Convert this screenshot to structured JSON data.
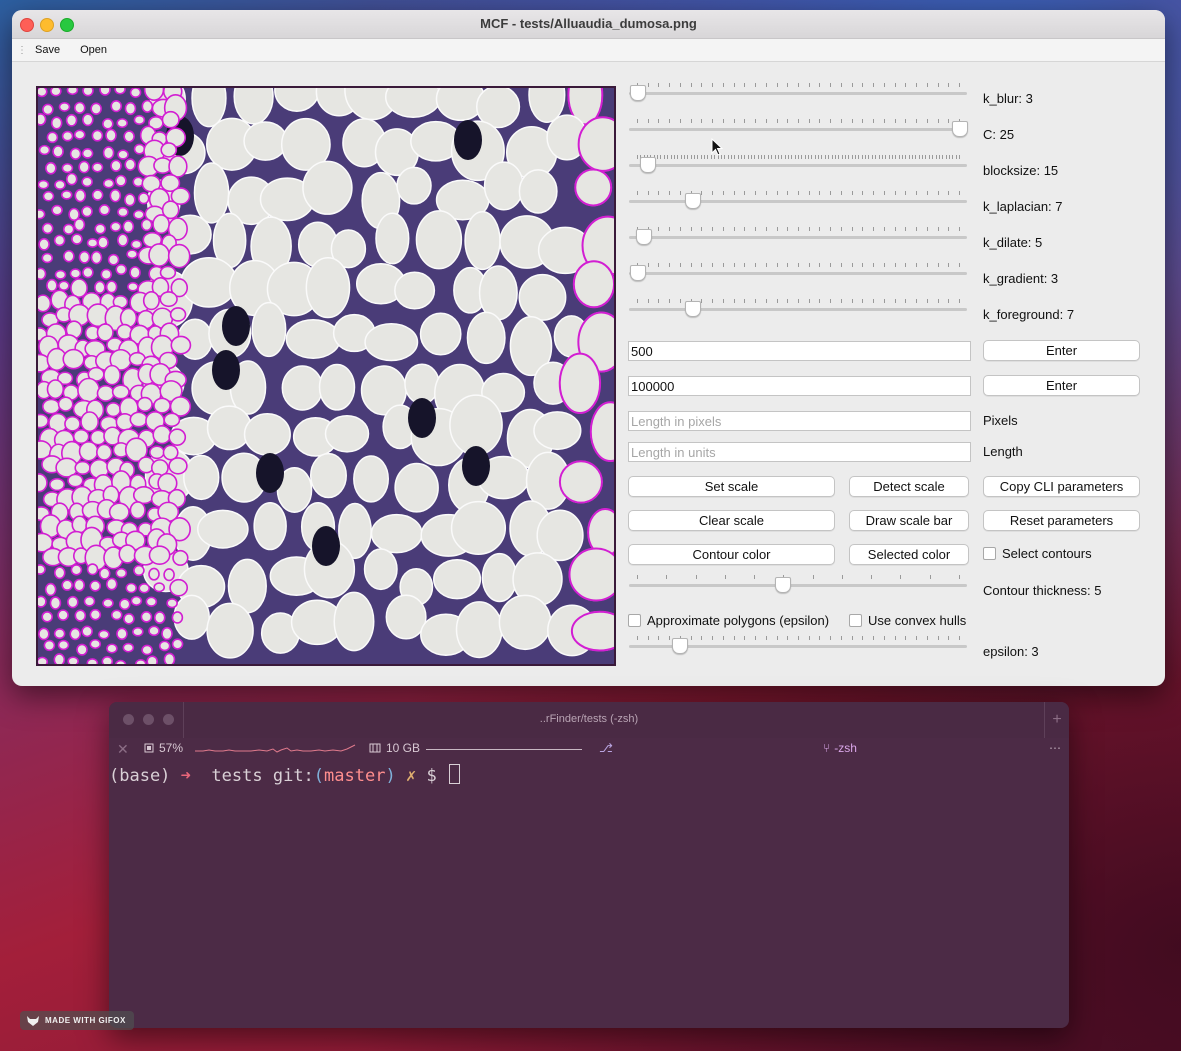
{
  "window": {
    "title": "MCF - tests/Alluaudia_dumosa.png",
    "menu": [
      "Save",
      "Open"
    ]
  },
  "sliders": [
    {
      "name": "k_blur",
      "label": "k_blur: 3",
      "fraction": 0.0
    },
    {
      "name": "C",
      "label": "C: 25",
      "fraction": 1.0
    },
    {
      "name": "blocksize",
      "label": "blocksize: 15",
      "fraction": 0.03
    },
    {
      "name": "k_laplacian",
      "label": "k_laplacian: 7",
      "fraction": 0.17
    },
    {
      "name": "k_dilate",
      "label": "k_dilate: 5",
      "fraction": 0.02
    },
    {
      "name": "k_gradient",
      "label": "k_gradient: 3",
      "fraction": 0.0
    },
    {
      "name": "k_foreground",
      "label": "k_foreground: 7",
      "fraction": 0.17
    }
  ],
  "inputs": {
    "min_area_value": "500",
    "max_area_value": "100000",
    "enter_label": "Enter",
    "pixels_placeholder": "Length in pixels",
    "pixels_label": "Pixels",
    "units_placeholder": "Length in units",
    "units_label": "Length"
  },
  "buttons": {
    "set_scale": "Set scale",
    "detect_scale": "Detect scale",
    "copy_cli": "Copy CLI parameters",
    "clear_scale": "Clear scale",
    "draw_scale_bar": "Draw scale bar",
    "reset_parameters": "Reset parameters",
    "contour_color": "Contour color",
    "selected_color": "Selected color"
  },
  "checkboxes": {
    "select_contours": "Select contours",
    "approx_polygons": "Approximate polygons (epsilon)",
    "convex_hulls": "Use convex hulls"
  },
  "contour_thickness": {
    "label": "Contour thickness: 5",
    "fraction": 0.45
  },
  "epsilon": {
    "label": "epsilon: 3",
    "fraction": 0.13
  },
  "colors": {
    "contour": "#d21ed2",
    "background_cell": "#e6e6e2",
    "stain": "#3a2a6a"
  },
  "terminal": {
    "title": "..rFinder/tests (-zsh)",
    "cpu": "57%",
    "memory": "10 GB",
    "session": "-zsh",
    "prompt": {
      "env": "(base)",
      "arrow": "➜",
      "dir": "tests",
      "git_prefix": "git:",
      "open_paren": "(",
      "branch": "master",
      "close_paren": ")",
      "dirty": "✗",
      "dollar": "$"
    }
  },
  "watermark": "MADE WITH GIFOX"
}
